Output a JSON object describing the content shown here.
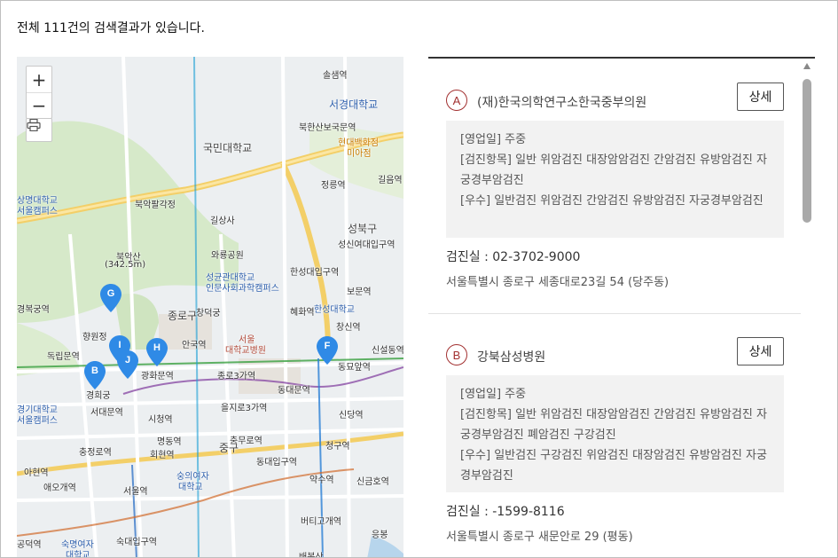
{
  "header": {
    "result_count_text": "전체 111건의 검색결과가 있습니다."
  },
  "map": {
    "zoom_in_label": "+",
    "zoom_out_label": "−",
    "labels": {
      "seokgwan": "솔샘역",
      "seokyeong_univ": "서경대학교",
      "bukhansanbogung": "북한산보국문역",
      "kookmin_univ": "국민대학교",
      "hyundai_museum": "현대백화점",
      "miasa": "미아점",
      "jeongneung": "정릉역",
      "gireum": "길음역",
      "sangmyung_univ": "상명대학교",
      "seoul_campus": "서울캠퍼스",
      "bugakpalgakjeong": "북악팔각정",
      "gilsangsa": "길상사",
      "seongbuk_gu": "성북구",
      "sungshin": "성신여대입구역",
      "bugaksan": "북악산",
      "bugaksan_height": "(342.5m)",
      "waryong_park": "와룡공원",
      "hansung_univ_station": "한성대입구역",
      "skku": "성균관대학교",
      "skku_campus": "인문사회과학캠퍼스",
      "bomun": "보문역",
      "gyeongbokgung": "경복궁역",
      "hyehwa": "혜화역",
      "hansung_univ": "한성대학교",
      "jongno_gu": "종로구",
      "changdeokgung": "창덕궁",
      "seoul_univ_hospital": "서울",
      "seoul_univ_hospital_2": "대학교병원",
      "changsin": "창신역",
      "hyangwon": "향원정",
      "anguk": "안국역",
      "dongmyo": "동묘앞역",
      "sinseoldong": "신설동역",
      "dongnimmun": "독립문역",
      "gwanghwamun": "광화문역",
      "jongno3ga": "종로3가역",
      "dongdaemun": "동대문역",
      "gyeonghuigung": "경희궁",
      "gyeonggi_univ": "경기대학교",
      "gyeonggi_campus": "서울캠퍼스",
      "seodaemun": "서대문역",
      "cityhall": "시청역",
      "euljiro3ga": "을지로3가역",
      "sindang": "신당역",
      "myeongdong": "명동역",
      "chungmuro": "충무로역",
      "junggu": "중구",
      "chungjeongno": "충정로역",
      "hoehyeon": "회현역",
      "cheonggu": "청구역",
      "ahyeon": "아현역",
      "sookmyung_top": "숭의여자",
      "sookmyung_top2": "대학교",
      "dongdaeipgu": "동대입구역",
      "aeogae": "애오개역",
      "seoul_station": "서울역",
      "yaksu": "약수역",
      "singeumho": "신금호역",
      "beotigogae": "버티고개역",
      "gongdeok": "공덕역",
      "sookmyung_univ": "숙명여자",
      "sookmyung_univ2": "대학교",
      "sookdae": "숙대입구역",
      "eungbong": "응봉",
      "hwarang": "배봉산"
    },
    "markers": [
      "G",
      "I",
      "J",
      "H",
      "B",
      "F"
    ],
    "colors": {
      "marker": "#2f8ae6",
      "road_major": "#f5d36b",
      "road_minor": "#ffffff",
      "park": "#d4e8c7",
      "water": "#b7d5ec"
    }
  },
  "results": [
    {
      "letter": "A",
      "name": "(재)한국의학연구소한국중부의원",
      "detail_label": "상세",
      "hours": "[영업일] 주중",
      "exam_items": "[검진항목] 일반 위암검진 대장암암검진 간암검진 유방암검진 자궁경부암검진",
      "excellent": "[우수] 일반검진 위암검진 간암검진 유방암검진 자궁경부암검진",
      "phone": "검진실 :  02-3702-9000",
      "address": "서울특별시 종로구 세종대로23길 54 (당주동)"
    },
    {
      "letter": "B",
      "name": "강북삼성병원",
      "detail_label": "상세",
      "hours": "[영업일] 주중",
      "exam_items": "[검진항목] 일반 위암검진 대장암암검진 간암검진 유방암검진 자궁경부암검진 폐암검진 구강검진",
      "excellent": "[우수] 일반검진 구강검진 위암검진 대장암검진 유방암검진 자궁경부암검진",
      "phone": "검진실 :  -1599-8116",
      "address": "서울특별시 종로구 새문안로 29 (평동)"
    }
  ]
}
